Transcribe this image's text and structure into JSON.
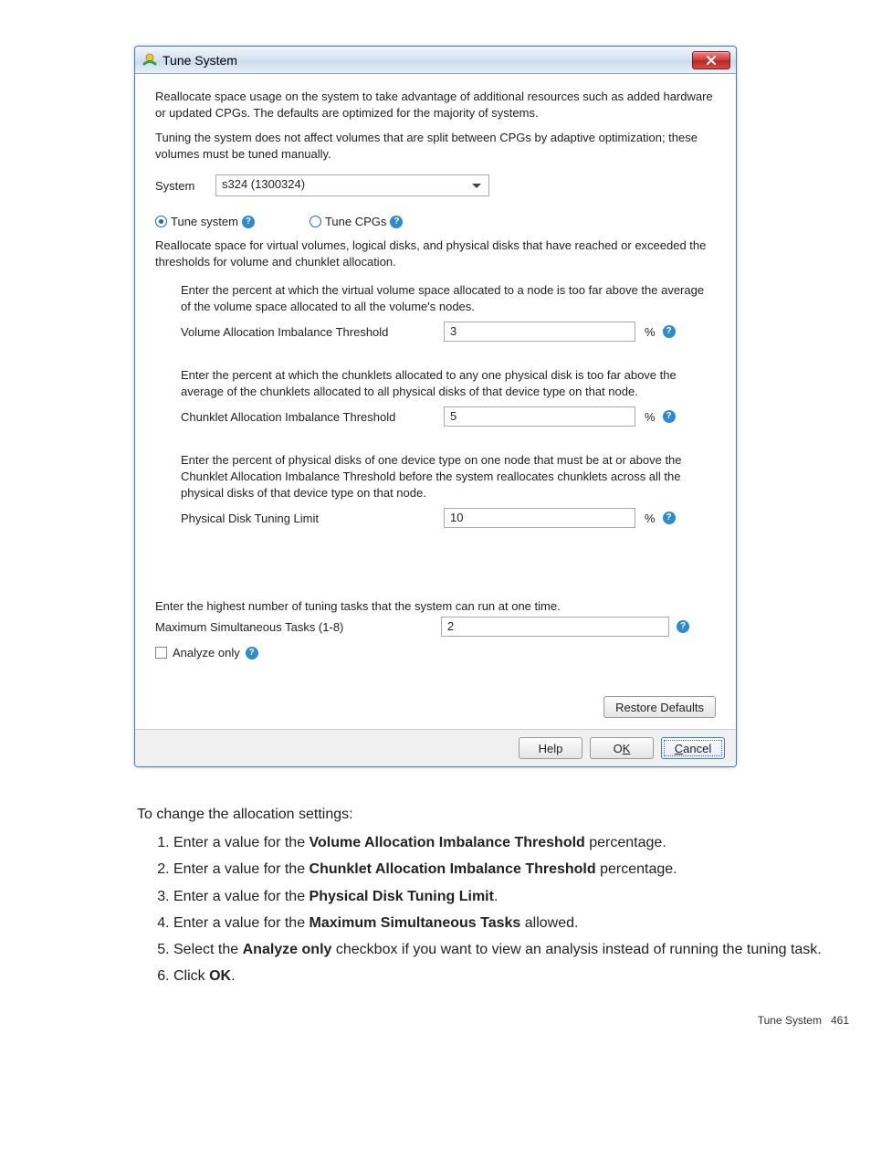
{
  "dialog": {
    "title": "Tune System",
    "desc1": "Reallocate space usage on the system to take advantage of additional resources such as added hardware or updated CPGs. The defaults are optimized for the majority of systems.",
    "desc2": "Tuning the system does not affect volumes that are split between CPGs by adaptive optimization; these volumes must be tuned manually.",
    "system_label": "System",
    "system_value": "s324 (1300324)",
    "radio_tune_system": "Tune system",
    "radio_tune_cpgs": "Tune CPGs",
    "radio_desc": "Reallocate space for virtual volumes, logical disks, and physical disks that have reached or exceeded the thresholds for volume and chunklet allocation.",
    "vol": {
      "prompt": "Enter the percent at which the virtual volume space allocated to a node is too far above the average of the volume space allocated to all the volume's nodes.",
      "label": "Volume Allocation Imbalance Threshold",
      "value": "3",
      "unit": "%"
    },
    "chunk": {
      "prompt": "Enter the percent at which the chunklets allocated to any one physical disk is too far above the average of the chunklets allocated to all physical disks of that device type on that node.",
      "label": "Chunklet Allocation Imbalance Threshold",
      "value": "5",
      "unit": "%"
    },
    "pdisk": {
      "prompt": "Enter the percent of physical disks of one device type on one node that must be at or above the Chunklet Allocation Imbalance Threshold before the system reallocates chunklets across all the physical disks of that device type on that node.",
      "label": "Physical Disk Tuning Limit",
      "value": "10",
      "unit": "%"
    },
    "tasks": {
      "prompt": "Enter the highest number of tuning tasks that the system can run at one time.",
      "label": "Maximum Simultaneous Tasks (1-8)",
      "value": "2"
    },
    "analyze_only": "Analyze only",
    "restore_label": "Restore Defaults",
    "help": "Help",
    "ok_prefix": "O",
    "ok_k": "K",
    "cancel_c": "C",
    "cancel_rest": "ancel"
  },
  "doc": {
    "intro": "To change the allocation settings:",
    "s1a": "Enter a value for the ",
    "s1b": "Volume Allocation Imbalance Threshold",
    "s1c": " percentage.",
    "s2a": "Enter a value for the ",
    "s2b": "Chunklet Allocation Imbalance Threshold",
    "s2c": " percentage.",
    "s3a": "Enter a value for the ",
    "s3b": "Physical Disk Tuning Limit",
    "s3c": ".",
    "s4a": "Enter a value for the ",
    "s4b": "Maximum Simultaneous Tasks",
    "s4c": " allowed.",
    "s5a": "Select the ",
    "s5b": "Analyze only",
    "s5c": " checkbox if you want to view an analysis instead of running the tuning task.",
    "s6a": "Click ",
    "s6b": "OK",
    "s6c": "."
  },
  "footer": {
    "section": "Tune System",
    "page": "461"
  }
}
